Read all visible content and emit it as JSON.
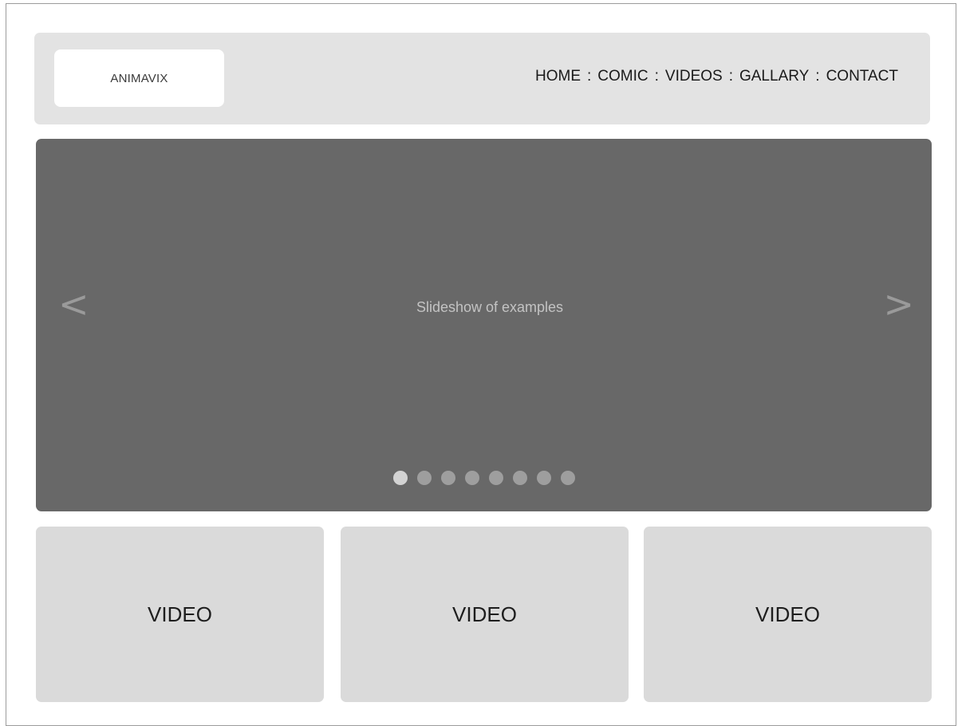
{
  "logo": {
    "text": "ANIMAVIX"
  },
  "nav": {
    "items": [
      {
        "label": "HOME"
      },
      {
        "label": "COMIC"
      },
      {
        "label": "VIDEOS"
      },
      {
        "label": "GALLARY"
      },
      {
        "label": "CONTACT"
      }
    ],
    "separator": ":"
  },
  "slideshow": {
    "caption": "Slideshow of examples",
    "prev_icon": "<",
    "next_icon": ">",
    "dot_count": 8,
    "active_index": 0
  },
  "videos": [
    {
      "label": "VIDEO"
    },
    {
      "label": "VIDEO"
    },
    {
      "label": "VIDEO"
    }
  ],
  "colors": {
    "header_bg": "#e3e3e3",
    "slideshow_bg": "#686868",
    "card_bg": "#dadada"
  }
}
